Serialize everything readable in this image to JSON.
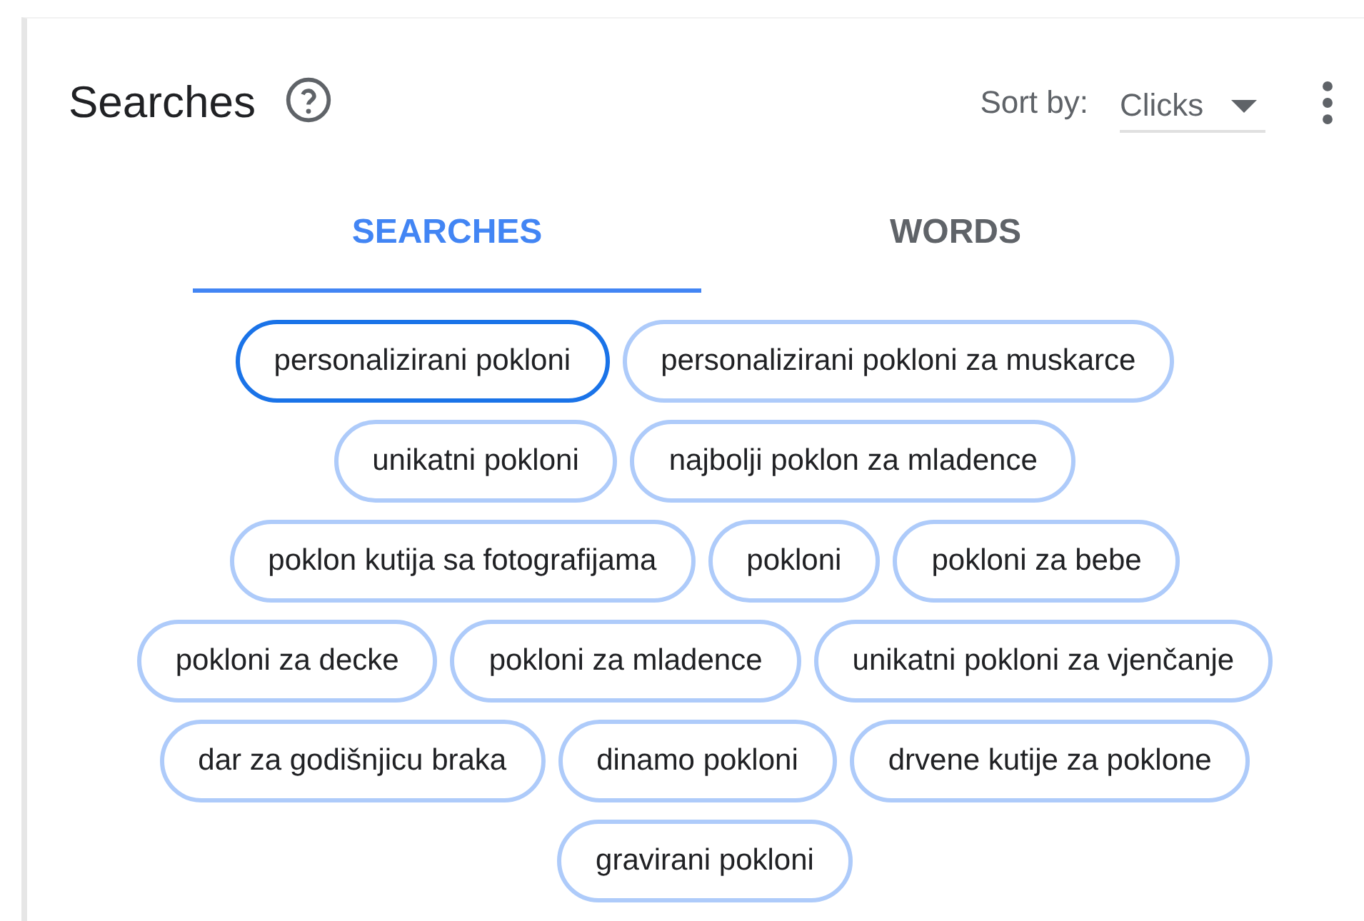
{
  "card": {
    "title": "Searches",
    "sort_label": "Sort by:",
    "sort_value": "Clicks"
  },
  "tabs": [
    {
      "label": "SEARCHES",
      "selected": true
    },
    {
      "label": "WORDS",
      "selected": false
    }
  ],
  "chips": [
    {
      "label": "personalizirani pokloni",
      "selected": true
    },
    {
      "label": "personalizirani pokloni za muskarce",
      "selected": false
    },
    {
      "label": "unikatni pokloni",
      "selected": false
    },
    {
      "label": "najbolji poklon za mladence",
      "selected": false
    },
    {
      "label": "poklon kutija sa fotografijama",
      "selected": false
    },
    {
      "label": "pokloni",
      "selected": false
    },
    {
      "label": "pokloni za bebe",
      "selected": false
    },
    {
      "label": "pokloni za decke",
      "selected": false
    },
    {
      "label": "pokloni za mladence",
      "selected": false
    },
    {
      "label": "unikatni pokloni za vjenčanje",
      "selected": false
    },
    {
      "label": "dar za godišnjicu braka",
      "selected": false
    },
    {
      "label": "dinamo pokloni",
      "selected": false
    },
    {
      "label": "drvene kutije za poklone",
      "selected": false
    },
    {
      "label": "gravirani pokloni",
      "selected": false
    }
  ]
}
